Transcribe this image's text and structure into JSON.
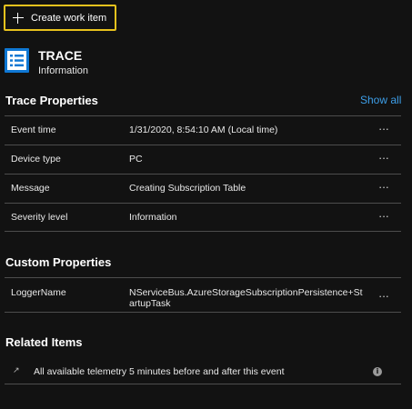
{
  "toolbar": {
    "create_label": "Create work item"
  },
  "header": {
    "title": "TRACE",
    "subtitle": "Information",
    "icon": "list-icon",
    "icon_color": "#0f78d4"
  },
  "trace_properties": {
    "title": "Trace Properties",
    "show_all": "Show all",
    "rows": [
      {
        "key": "Event time",
        "value": "1/31/2020, 8:54:10 AM (Local time)",
        "menu": "···"
      },
      {
        "key": "Device type",
        "value": "PC",
        "menu": "···"
      },
      {
        "key": "Message",
        "value": "Creating Subscription Table",
        "menu": "···"
      },
      {
        "key": "Severity level",
        "value": "Information",
        "menu": "···"
      }
    ]
  },
  "custom_properties": {
    "title": "Custom Properties",
    "rows": [
      {
        "key": "LoggerName",
        "value_line1": "NServiceBus.AzureStorageSubscriptionPersistence+St",
        "value_line2": "artupTask",
        "menu": "···"
      }
    ]
  },
  "related_items": {
    "title": "Related Items",
    "items": [
      {
        "icon": "arrow-up-right-icon",
        "text": "All available telemetry 5 minutes before and after this event",
        "info_icon": "info-icon",
        "info_glyph": "i"
      }
    ]
  },
  "colors": {
    "accent": "#3d9ee8",
    "focus_border": "#e8c21d",
    "background": "#121212"
  }
}
